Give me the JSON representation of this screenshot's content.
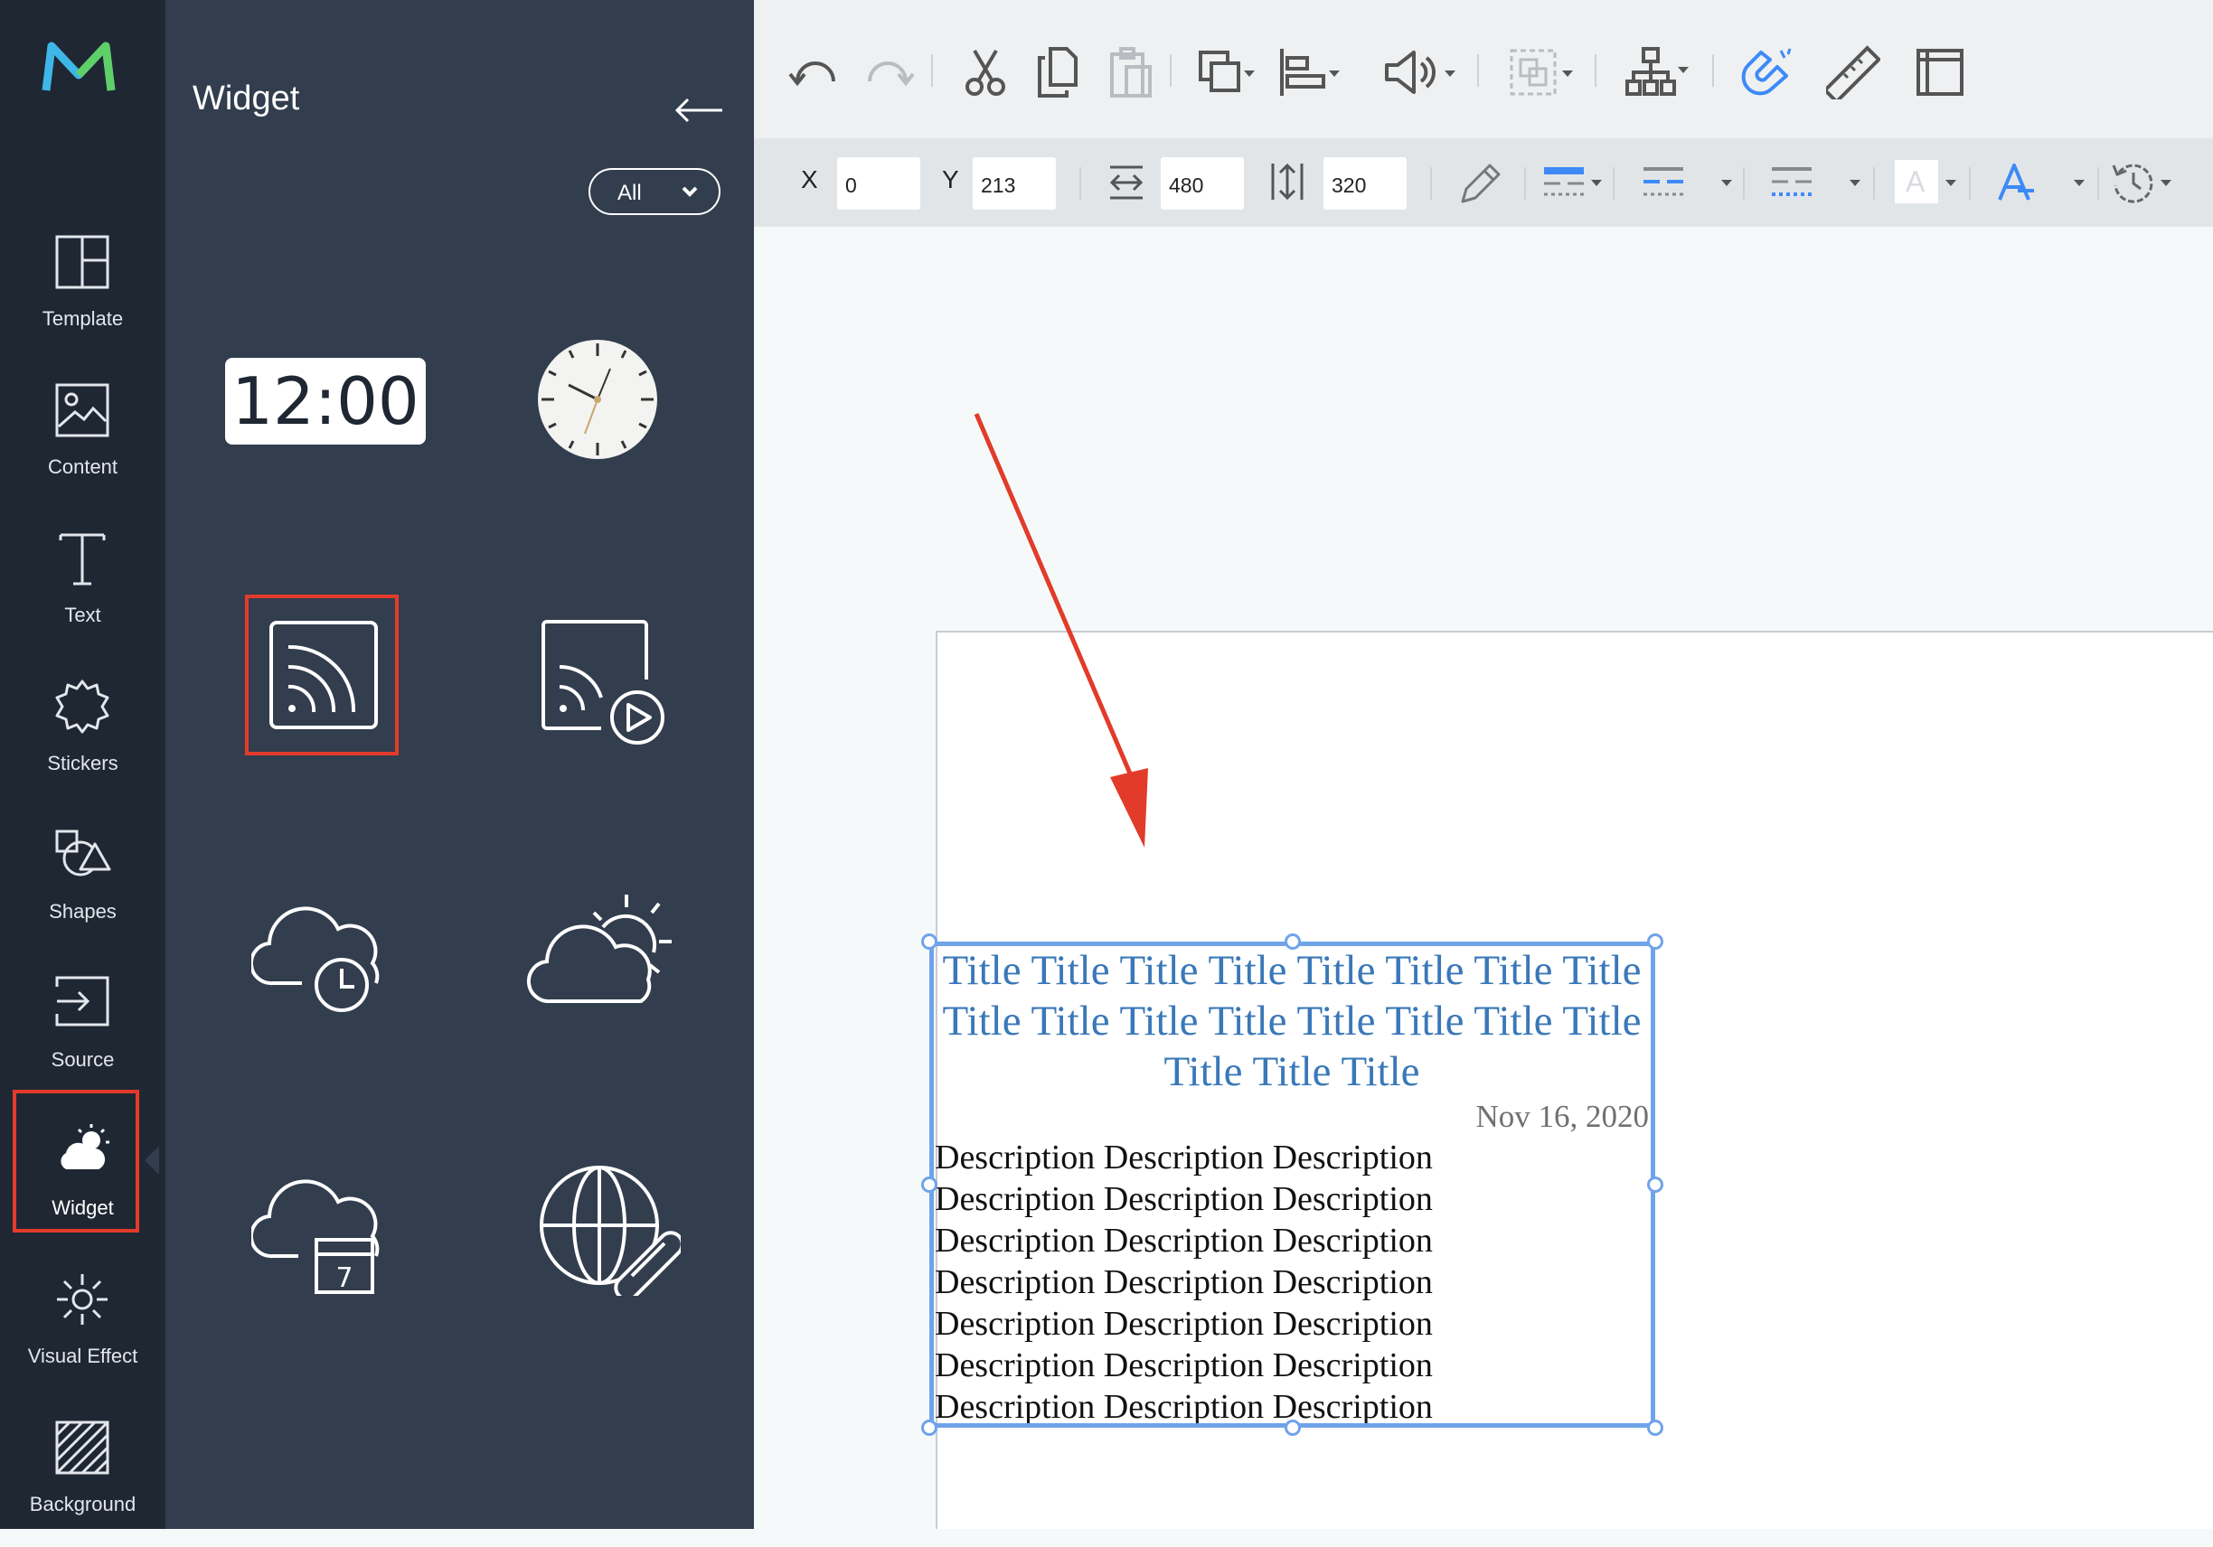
{
  "sidebar": {
    "items": [
      {
        "label": "Template",
        "icon": "layout-icon"
      },
      {
        "label": "Content",
        "icon": "image-icon"
      },
      {
        "label": "Text",
        "icon": "text-icon"
      },
      {
        "label": "Stickers",
        "icon": "sticker-icon"
      },
      {
        "label": "Shapes",
        "icon": "shapes-icon"
      },
      {
        "label": "Source",
        "icon": "source-icon"
      },
      {
        "label": "Widget",
        "icon": "weather-widget-icon",
        "active": true
      },
      {
        "label": "Visual Effect",
        "icon": "visual-effect-icon"
      },
      {
        "label": "Background",
        "icon": "background-icon"
      }
    ]
  },
  "panel": {
    "title": "Widget",
    "filter_value": "All",
    "widgets": [
      {
        "icon": "digital-clock-widget",
        "text": "12:00"
      },
      {
        "icon": "analog-clock-widget"
      },
      {
        "icon": "rss-widget",
        "selected": true
      },
      {
        "icon": "rss-video-widget"
      },
      {
        "icon": "cloud-clock-widget"
      },
      {
        "icon": "weather-widget"
      },
      {
        "icon": "cloud-calendar-widget",
        "text": "7"
      },
      {
        "icon": "web-link-widget"
      }
    ]
  },
  "properties": {
    "x_label": "X",
    "x_value": "0",
    "y_label": "Y",
    "y_value": "213",
    "width_value": "480",
    "height_value": "320"
  },
  "canvas": {
    "rss_title": "Title Title Title Title Title Title Title Title Title Title Title Title Title Title Title Title Title Title Title",
    "rss_date": "Nov 16, 2020",
    "rss_description": [
      "Description Description Description",
      "Description Description Description",
      "Description Description Description",
      "Description Description Description",
      "Description Description Description",
      "Description Description Description",
      "Description Description Description"
    ]
  },
  "colors": {
    "rail_bg": "#1f2733",
    "panel_bg": "#323d4d",
    "highlight_red": "#e23b2a",
    "selection_blue": "#6fa3ea",
    "title_blue": "#3a78b8",
    "accent_blue": "#3d8af7"
  }
}
